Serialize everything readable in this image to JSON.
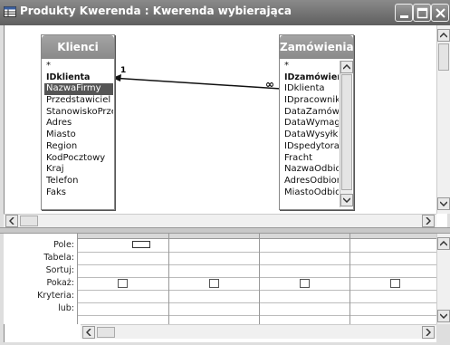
{
  "window": {
    "title": "Produkty Kwerenda : Kwerenda wybierająca"
  },
  "tables": {
    "klienci": {
      "name": "Klienci",
      "fields": [
        "*",
        "IDklienta",
        "NazwaFirmy",
        "Przedstawiciel",
        "StanowiskoPrzedst",
        "Adres",
        "Miasto",
        "Region",
        "KodPocztowy",
        "Kraj",
        "Telefon",
        "Faks"
      ],
      "selected_field": "NazwaFirmy",
      "key_field": "IDklienta"
    },
    "zamowienia": {
      "name": "Zamówienia",
      "fields": [
        "*",
        "IDzamówienia",
        "IDklienta",
        "IDpracownika",
        "DataZamówienia",
        "DataWymagana",
        "DataWysyłki",
        "IDspedytora",
        "Fracht",
        "NazwaOdbiorcy",
        "AdresOdbiorcy",
        "MiastoOdbiorcy"
      ],
      "key_field": "IDzamówienia"
    }
  },
  "relationship": {
    "one_label": "1",
    "many_label": "∞"
  },
  "grid": {
    "row_labels": [
      "Pole:",
      "Tabela:",
      "Sortuj:",
      "Pokaż:",
      "Kryteria:",
      "lub:"
    ],
    "columns": 4
  },
  "icons": {
    "app": "query-icon",
    "minimize": "minimize-icon",
    "maximize": "maximize-icon",
    "close": "close-icon"
  }
}
